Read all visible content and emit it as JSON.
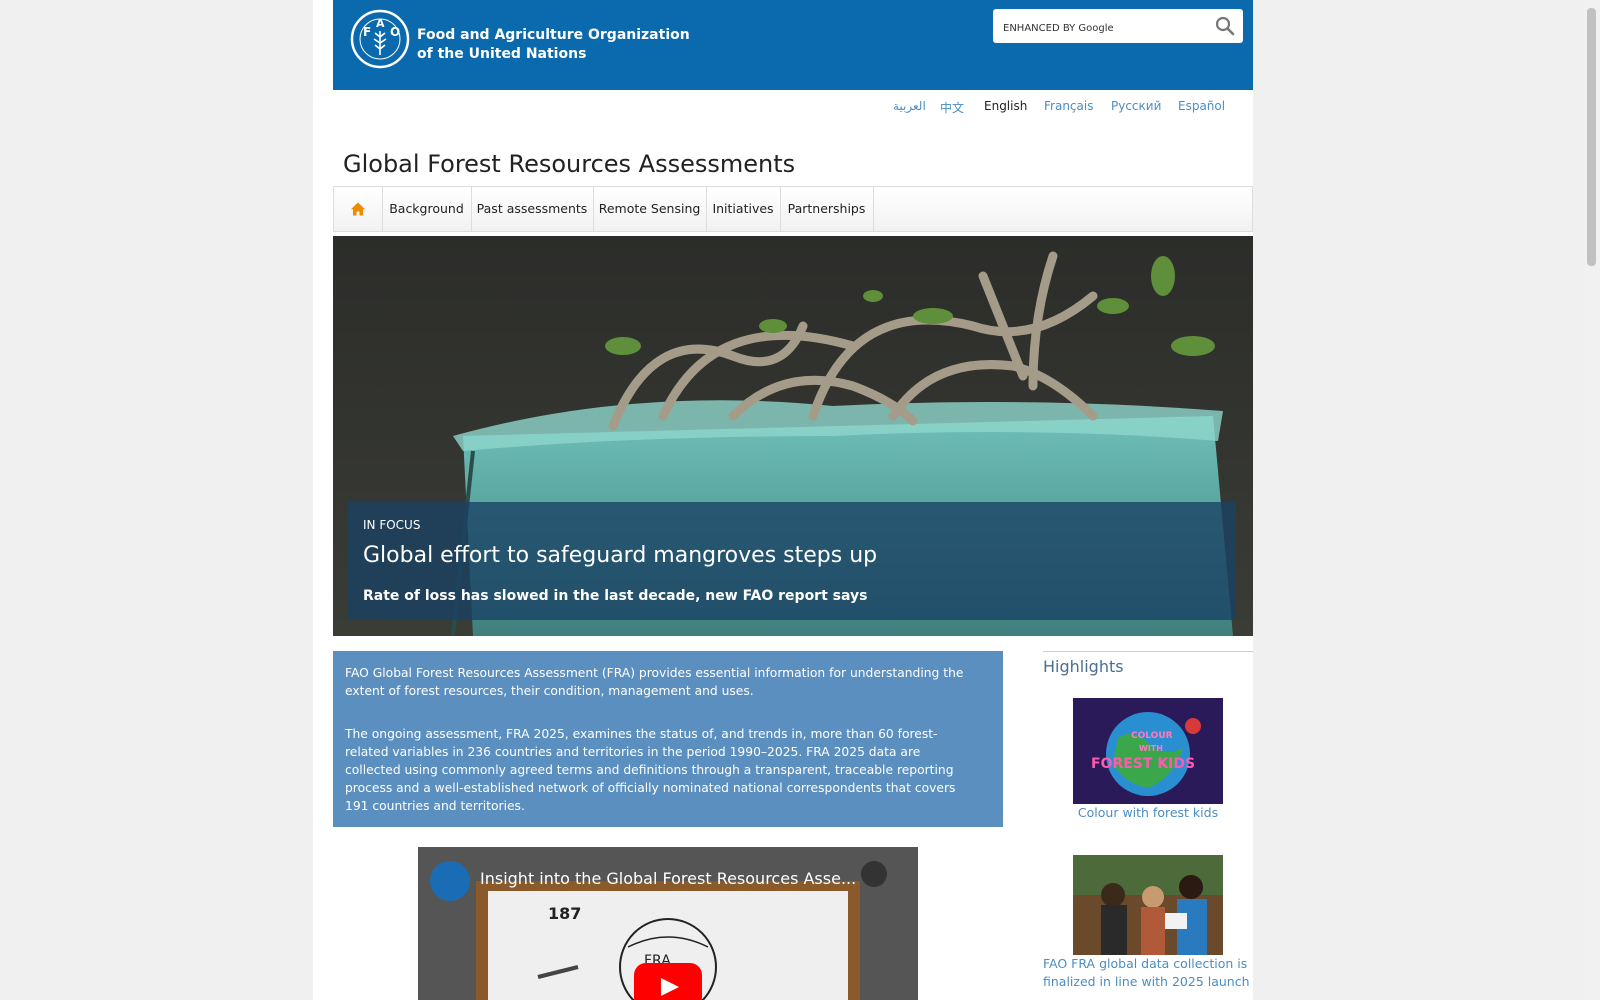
{
  "header": {
    "org_name_line1": "Food and Agriculture Organization",
    "org_name_line2": "of the United Nations",
    "brand_color": "#0a6aad",
    "search": {
      "placeholder": "ENHANCED BY Google"
    }
  },
  "languages": [
    {
      "label": "العربية",
      "active": false
    },
    {
      "label": "中文",
      "active": false
    },
    {
      "label": "English",
      "active": true
    },
    {
      "label": "Français",
      "active": false
    },
    {
      "label": "Русский",
      "active": false
    },
    {
      "label": "Español",
      "active": false
    }
  ],
  "site_title": "Global Forest Resources Assessments",
  "nav": {
    "home_icon": "home-icon",
    "items": [
      "Background",
      "Past assessments",
      "Remote Sensing",
      "Initiatives",
      "Partnerships"
    ]
  },
  "hero": {
    "kicker": "IN FOCUS",
    "title": "Global effort to safeguard mangroves steps up",
    "subtitle": "Rate of loss has slowed in the last decade, new FAO report says"
  },
  "intro": {
    "p1": "FAO Global Forest Resources Assessment (FRA) provides essential information for understanding the extent of forest resources, their condition, management and uses.",
    "p2": "The ongoing assessment, FRA 2025, examines the status of, and trends in, more than 60 forest-related variables in 236 countries and territories in the period 1990–2025. FRA 2025 data are collected using commonly agreed terms and definitions through a transparent, traceable reporting process and a well-established network of officially nominated national correspondents that covers 191 countries and territories."
  },
  "video": {
    "title": "Insight into the Global Forest Resources Asse..."
  },
  "highlights": {
    "title": "Highlights",
    "items": [
      {
        "caption": "Colour with forest kids"
      },
      {
        "caption": "FAO FRA global data collection is finalized in line with 2025 launch"
      }
    ]
  }
}
